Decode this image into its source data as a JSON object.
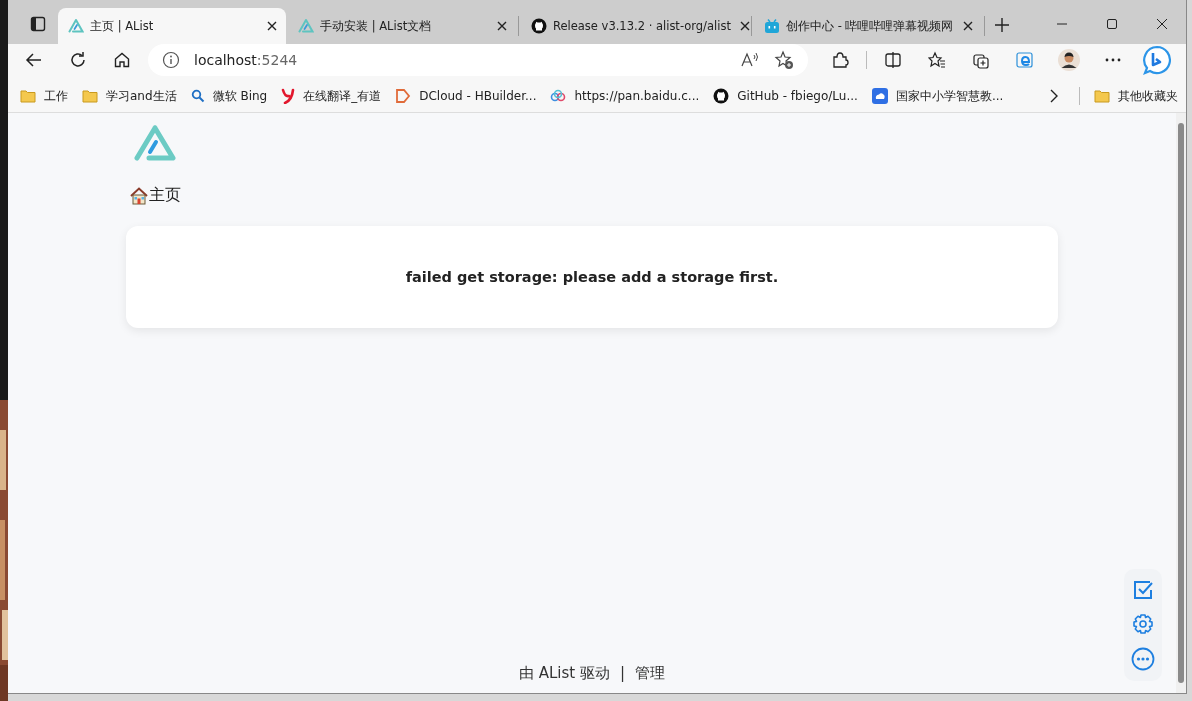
{
  "tabs": [
    {
      "title": "主页 | AList",
      "kind": "alist",
      "selected": true
    },
    {
      "title": "手动安装 | AList文档",
      "kind": "alist",
      "selected": false
    },
    {
      "title": "Release v3.13.2 · alist-org/alist",
      "kind": "github",
      "selected": false
    },
    {
      "title": "创作中心 - 哔哩哔哩弹幕视频网",
      "kind": "tv",
      "selected": false
    }
  ],
  "address": {
    "host": "localhost",
    "port": ":5244"
  },
  "bookmarks": [
    {
      "label": "工作",
      "kind": "folder"
    },
    {
      "label": "学习and生活",
      "kind": "folder"
    },
    {
      "label": "微软 Bing",
      "kind": "search"
    },
    {
      "label": "在线翻译_有道",
      "kind": "y"
    },
    {
      "label": "DCloud - HBuilder...",
      "kind": "tag"
    },
    {
      "label": "https://pan.baidu.c...",
      "kind": "cloud"
    },
    {
      "label": "GitHub - fbiego/Lu...",
      "kind": "github"
    },
    {
      "label": "国家中小学智慧教...",
      "kind": "edu"
    }
  ],
  "other_bookmarks": "其他收藏夹",
  "page": {
    "breadcrumb": "主页",
    "message": "failed get storage: please add a storage first.",
    "footer": {
      "powered": "由 AList 驱动",
      "separator": "|",
      "manage": "管理"
    }
  }
}
